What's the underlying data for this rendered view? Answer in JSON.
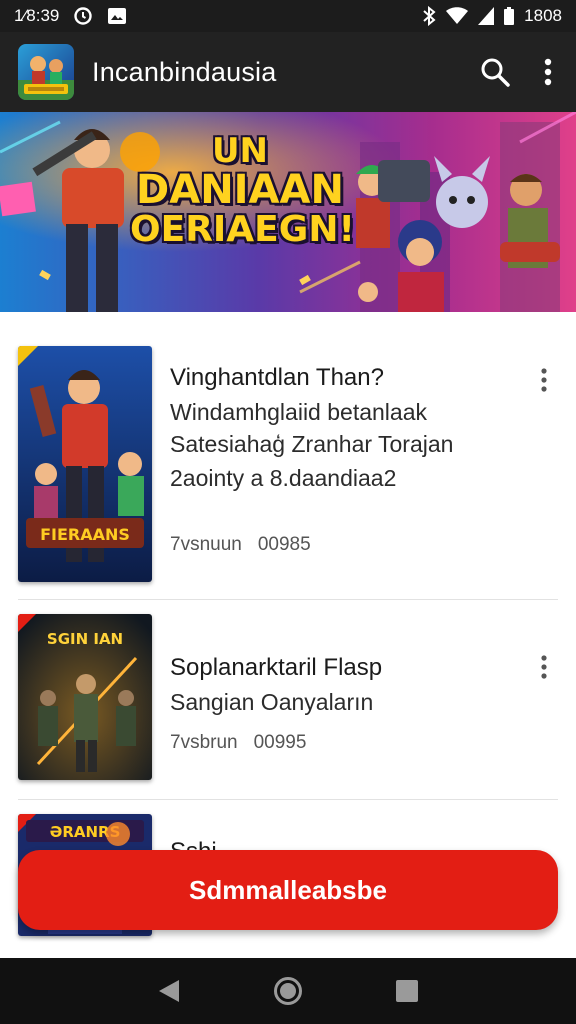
{
  "status_bar": {
    "time": "1⁄8:39",
    "battery_text": "1808",
    "icons": [
      "alarm-icon",
      "image-notification-icon",
      "bluetooth-icon",
      "wifi-icon",
      "signal-icon",
      "battery-icon"
    ]
  },
  "app_bar": {
    "title": "Incanbindausia",
    "actions": [
      "search-icon",
      "more-vert-icon"
    ]
  },
  "banner": {
    "line1": "UN",
    "line2": "DANIAAN",
    "line3": "OERIAEGN!"
  },
  "items": [
    {
      "title": "Vinghantdlan Than?",
      "description": [
        "Windamhglaiid betanlaak",
        "Satesiahaģ Zranhar Torajan",
        "2aointy a 8.daandiaa2"
      ],
      "meta_1": "7vsnuun",
      "meta_2": "00985",
      "thumb_label": "FIERAANS"
    },
    {
      "title": "Soplanarktaril Flasp",
      "description": [
        "Sangian Oanyaların"
      ],
      "meta_1": "7vsbrun",
      "meta_2": "00995",
      "thumb_label": "SGIN IAN"
    },
    {
      "title": "Sshi",
      "thumb_label": "ƏRANRS"
    }
  ],
  "cta": {
    "label": "Sdmmalleabsbe",
    "color": "#e31e14"
  },
  "nav": [
    "back-icon",
    "home-icon",
    "recents-icon"
  ],
  "colors": {
    "app_bar": "#222222",
    "status_bar": "#1c1c1c",
    "accent": "#e31e14"
  }
}
